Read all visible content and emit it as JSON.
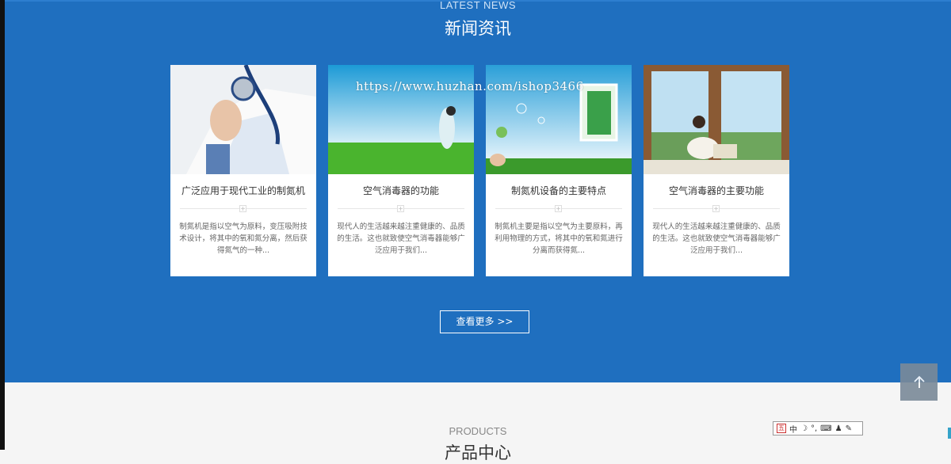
{
  "news": {
    "subtitle": "LATEST NEWS",
    "title": "新闻资讯",
    "more_button": "查看更多 >>",
    "cards": [
      {
        "title": "广泛应用于现代工业的制氮机",
        "desc": "制氮机是指以空气为原料，变压吸附技术设计，将其中的氧和氮分离，然后获得氮气的一种..."
      },
      {
        "title": "空气消毒器的功能",
        "desc": "现代人的生活越来越注重健康的、品质的生活。这也就致使空气消毒器能够广泛应用于我们..."
      },
      {
        "title": "制氮机设备的主要特点",
        "desc": "制氮机主要是指以空气为主要原料，再利用物理的方式，将其中的氧和氮进行分离而获得氮..."
      },
      {
        "title": "空气消毒器的主要功能",
        "desc": "现代人的生活越来越注重健康的、品质的生活。这也就致使空气消毒器能够广泛应用于我们..."
      }
    ]
  },
  "watermark": "https://www.huzhan.com/ishop3466",
  "products": {
    "subtitle": "PRODUCTS",
    "title": "产品中心"
  },
  "ime": {
    "mode": "中",
    "punct": "°,"
  },
  "colors": {
    "news_bg": "#1f6fbf",
    "page_bg": "#f5f5f5"
  }
}
